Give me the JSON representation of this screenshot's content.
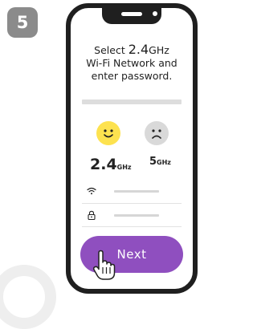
{
  "step": {
    "number": "5"
  },
  "instruction": {
    "line1_prefix": "Select ",
    "line1_band": "2.4",
    "line1_unit": "GHz",
    "line2": "Wi-Fi Network and",
    "line3": "enter password."
  },
  "bands": {
    "band_24_value": "2.4",
    "band_24_unit": "GHz",
    "band_5_value": "5",
    "band_5_unit": "GHz"
  },
  "emoji": {
    "happy": "happy-face",
    "sad": "sad-face"
  },
  "fields": {
    "wifi_icon": "wifi-icon",
    "lock_icon": "lock-icon"
  },
  "button": {
    "next_label": "Next"
  },
  "colors": {
    "accent": "#8f4fbf",
    "happy": "#fde24f",
    "neutral": "#d9d9d9",
    "badge": "#8b8b8b"
  }
}
